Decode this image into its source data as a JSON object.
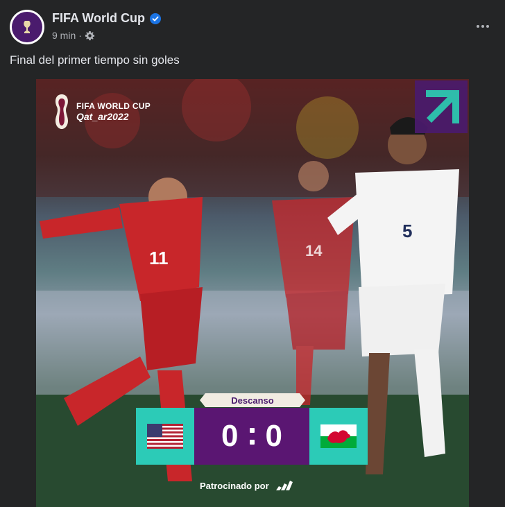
{
  "post": {
    "page_name": "FIFA World Cup",
    "time": "9 min",
    "separator": "·",
    "text": "Final del primer tiempo sin goles"
  },
  "media": {
    "logo_line1": "FIFA WORLD CUP",
    "logo_line2": "Qat_ar2022",
    "status": "Descanso",
    "home_score": "0",
    "away_score": "0",
    "sponsor_text": "Patrocinado por",
    "player_left_number": "11",
    "player_mid_number": "14",
    "player_right_number": "5"
  },
  "colors": {
    "background": "#242526",
    "accent_purple": "#5a1672",
    "accent_teal": "#2ccbb7",
    "verified_blue": "#1b74e4"
  },
  "icons": [
    "fifa-avatar",
    "verified-icon",
    "gear-icon",
    "more-icon",
    "expand-arrow-icon",
    "usa-flag-icon",
    "wales-flag-icon",
    "adidas-icon"
  ]
}
